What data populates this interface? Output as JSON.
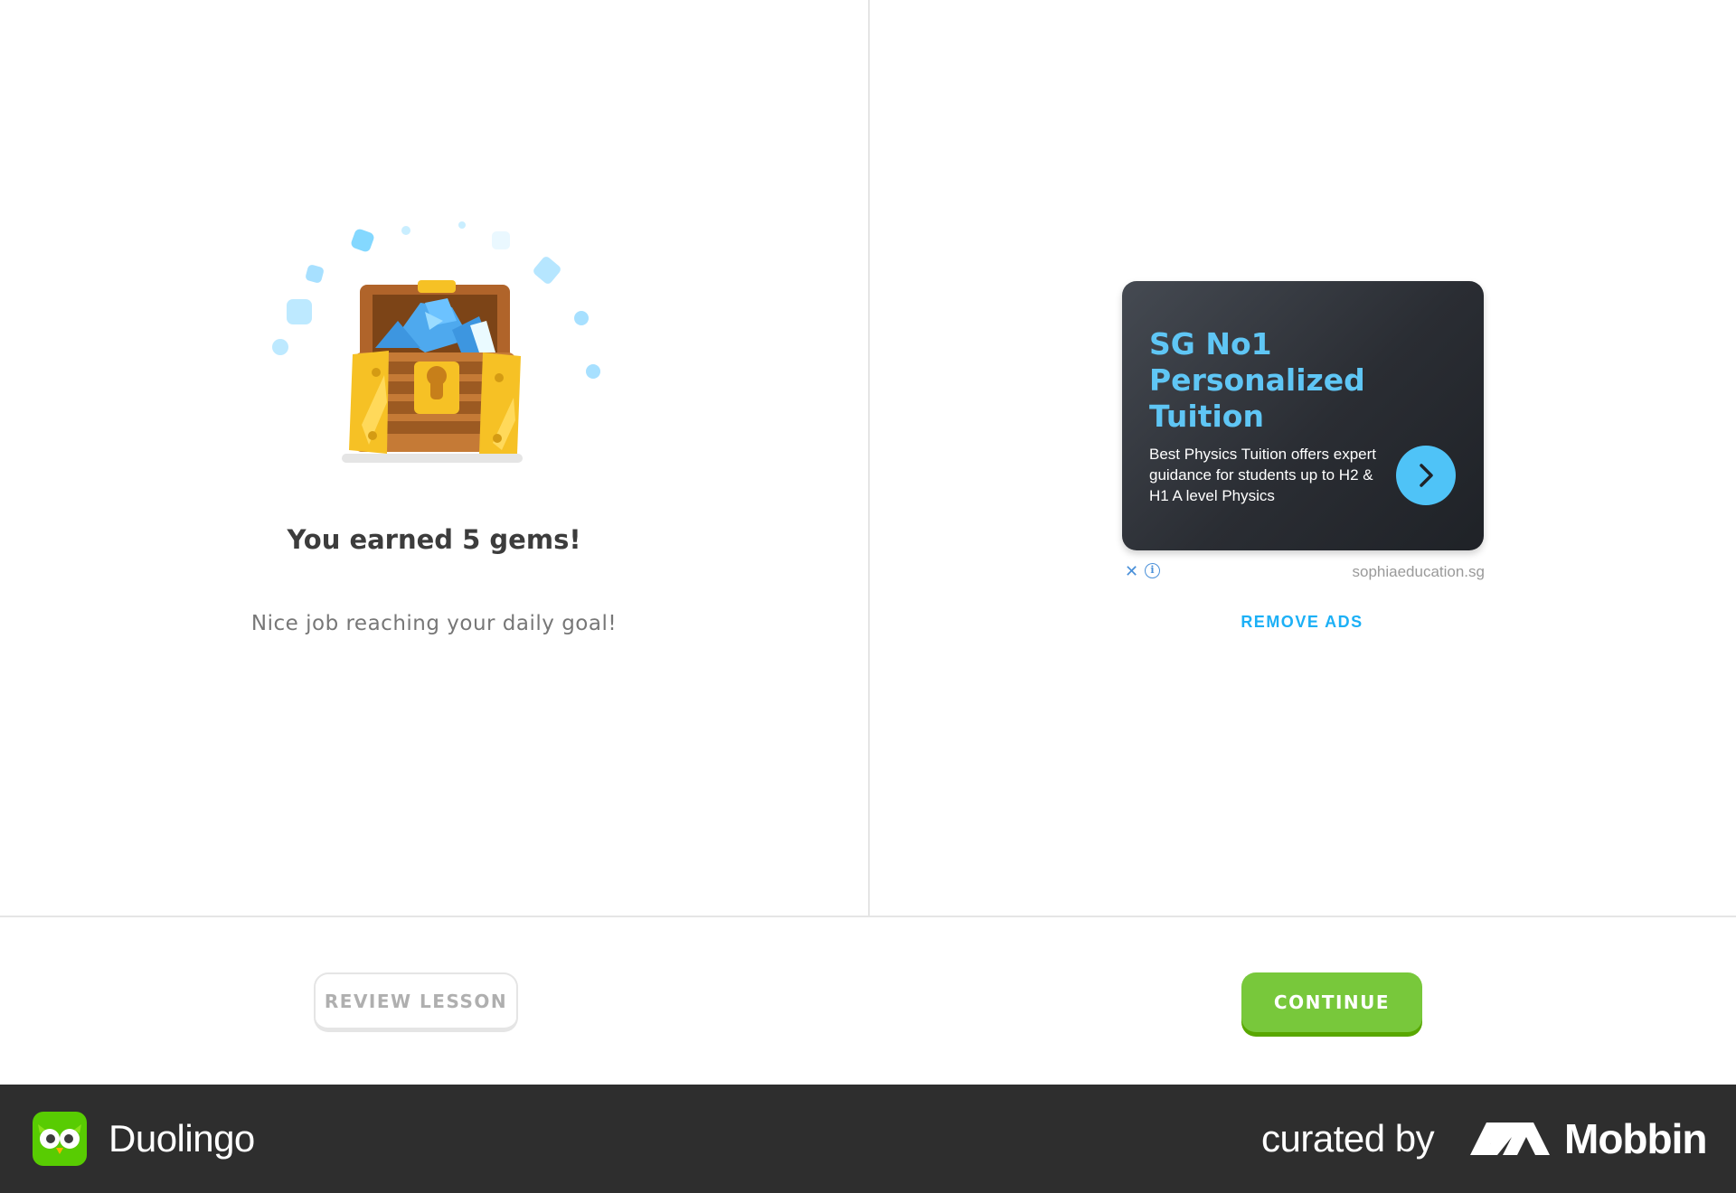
{
  "reward": {
    "title": "You earned 5 gems!",
    "subtitle": "Nice job reaching your daily goal!"
  },
  "ad": {
    "headline": "SG No1 Personalized Tuition",
    "body": "Best Physics Tuition offers expert guidance for students up to H2 & H1 A level Physics",
    "close_glyph": "✕",
    "info_glyph": "i",
    "domain": "sophiaeducation.sg",
    "remove_ads_label": "REMOVE ADS"
  },
  "actions": {
    "review_label": "REVIEW LESSON",
    "continue_label": "CONTINUE"
  },
  "banner": {
    "app_name": "Duolingo",
    "curated_label": "curated by",
    "brand_name": "Mobbin"
  },
  "colors": {
    "primary_green": "#78c83b",
    "ad_accent": "#4fc3f7",
    "link_blue": "#1cb0f6"
  }
}
